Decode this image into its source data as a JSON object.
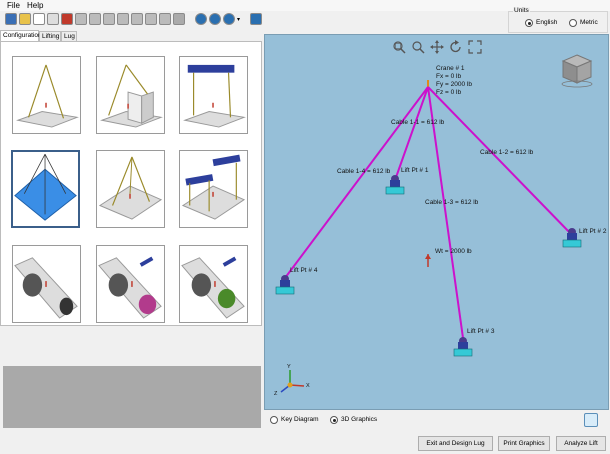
{
  "menu": {
    "file": "File",
    "help": "Help"
  },
  "toolbar": {
    "buttons": [
      "save-icon",
      "open-icon",
      "zoom-doc-icon",
      "print-icon",
      "block-icon",
      "cube-front-icon",
      "cube-side-icon",
      "cube-top-icon",
      "cube-iso-icon",
      "cube-back-icon",
      "cube-bottom-icon",
      "cube-wire-icon",
      "globe-icon",
      "help-icon",
      "camera-icon",
      "chevron-down-icon",
      "settings-icon"
    ]
  },
  "units": {
    "legend": "Units",
    "english": "English",
    "metric": "Metric",
    "selected": "English"
  },
  "tabs": {
    "configuration": "Configuration",
    "lifting": "Lifting",
    "lug": "Lug",
    "active": "Configuration"
  },
  "configurations": {
    "selected_index": 3,
    "count": 9
  },
  "viewport": {
    "crane_label": "Crane # 1",
    "fx": "Fx = 0 lb",
    "fy": "Fy = 2000 lb",
    "fz": "Fz = 0 lb",
    "cable_1_1": "Cable 1-1 = 612 lb",
    "cable_1_2": "Cable 1-2 = 612 lb",
    "cable_1_3": "Cable 1-3 = 612 lb",
    "cable_1_4": "Cable 1-4 = 612 lb",
    "lift_pt_1": "Lift Pt # 1",
    "lift_pt_2": "Lift Pt # 2",
    "lift_pt_3": "Lift Pt # 3",
    "lift_pt_4": "Lift Pt # 4",
    "weight": "Wt = 2000 lb",
    "axis_x": "X",
    "axis_y": "Y",
    "axis_z": "Z",
    "cable_color": "#cc11cc",
    "background_color": "#96bfd8"
  },
  "mode": {
    "key_diagram": "Key Diagram",
    "graphics_3d": "3D Graphics",
    "selected": "3D Graphics"
  },
  "actions": {
    "exit_design": "Exit and Design Lug",
    "print_graphics": "Print Graphics",
    "analyze": "Analyze Lift"
  }
}
